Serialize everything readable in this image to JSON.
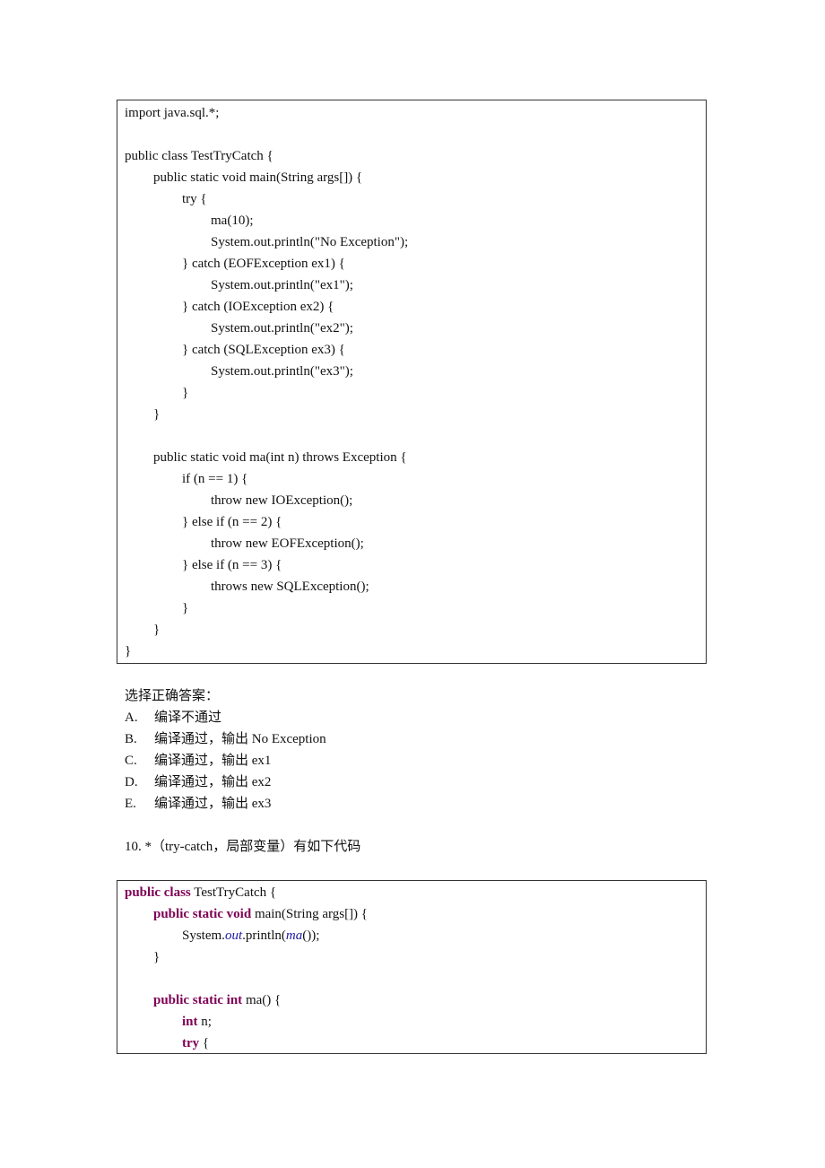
{
  "code_block_1": {
    "lines": [
      {
        "indent": 0,
        "text": "import java.sql.*;"
      },
      {
        "indent": 0,
        "text": ""
      },
      {
        "indent": 0,
        "text": "public class TestTryCatch {"
      },
      {
        "indent": 1,
        "text": "public static void main(String args[]) {"
      },
      {
        "indent": 2,
        "text": "try {"
      },
      {
        "indent": 3,
        "text": "ma(10);"
      },
      {
        "indent": 3,
        "text": "System.out.println(\"No Exception\");"
      },
      {
        "indent": 2,
        "text": "} catch (EOFException ex1) {"
      },
      {
        "indent": 3,
        "text": "System.out.println(\"ex1\");"
      },
      {
        "indent": 2,
        "text": "} catch (IOException ex2) {"
      },
      {
        "indent": 3,
        "text": "System.out.println(\"ex2\");"
      },
      {
        "indent": 2,
        "text": "} catch (SQLException ex3) {"
      },
      {
        "indent": 3,
        "text": "System.out.println(\"ex3\");"
      },
      {
        "indent": 2,
        "text": "}"
      },
      {
        "indent": 1,
        "text": "}"
      },
      {
        "indent": 0,
        "text": ""
      },
      {
        "indent": 1,
        "text": "public static void ma(int n) throws Exception {"
      },
      {
        "indent": 2,
        "text": "if (n == 1) {"
      },
      {
        "indent": 3,
        "text": "throw new IOException();"
      },
      {
        "indent": 2,
        "text": "} else if (n == 2) {"
      },
      {
        "indent": 3,
        "text": "throw new EOFException();"
      },
      {
        "indent": 2,
        "text": "} else if (n == 3) {"
      },
      {
        "indent": 3,
        "text": "throws new SQLException();"
      },
      {
        "indent": 2,
        "text": "}"
      },
      {
        "indent": 1,
        "text": "}"
      },
      {
        "indent": 0,
        "text": "}"
      }
    ]
  },
  "question_9": {
    "prompt": "选择正确答案：",
    "options": [
      {
        "label": "A.",
        "text": "编译不通过"
      },
      {
        "label": "B.",
        "text": "编译通过，输出 No Exception"
      },
      {
        "label": "C.",
        "text": "编译通过，输出 ex1"
      },
      {
        "label": "D.",
        "text": "编译通过，输出 ex2"
      },
      {
        "label": "E.",
        "text": "编译通过，输出 ex3"
      }
    ]
  },
  "question_10": {
    "title": "10. *（try-catch，局部变量）有如下代码"
  },
  "code_block_2": {
    "keyword_color": "#7f0055",
    "lines": [
      {
        "indent": 0,
        "segments": [
          {
            "t": "public class",
            "s": "kw"
          },
          {
            "t": " TestTryCatch {"
          }
        ]
      },
      {
        "indent": 1,
        "segments": [
          {
            "t": "public static void",
            "s": "kw"
          },
          {
            "t": " main(String args[]) {"
          }
        ]
      },
      {
        "indent": 2,
        "segments": [
          {
            "t": "System."
          },
          {
            "t": "out",
            "s": "it"
          },
          {
            "t": ".println("
          },
          {
            "t": "ma",
            "s": "it"
          },
          {
            "t": "());"
          }
        ]
      },
      {
        "indent": 1,
        "segments": [
          {
            "t": "}"
          }
        ]
      },
      {
        "indent": 0,
        "segments": []
      },
      {
        "indent": 1,
        "segments": [
          {
            "t": "public static int",
            "s": "kw"
          },
          {
            "t": " ma() {"
          }
        ]
      },
      {
        "indent": 2,
        "segments": [
          {
            "t": "int",
            "s": "kw"
          },
          {
            "t": " n;"
          }
        ]
      },
      {
        "indent": 2,
        "segments": [
          {
            "t": "try",
            "s": "kw"
          },
          {
            "t": " {"
          }
        ]
      }
    ]
  }
}
